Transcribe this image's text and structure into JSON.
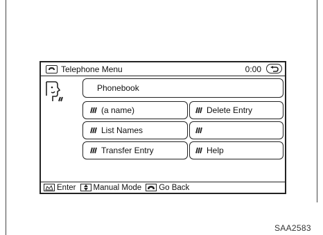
{
  "header": {
    "title": "Telephone Menu",
    "time": "0:00"
  },
  "main": {
    "phonebook_label": "Phonebook",
    "buttons": [
      {
        "label": "(a name)",
        "icon": "voice-icon"
      },
      {
        "label": "Delete Entry",
        "icon": "voice-icon"
      },
      {
        "label": "List Names",
        "icon": "voice-icon"
      },
      {
        "label": "",
        "icon": "voice-icon"
      },
      {
        "label": "Transfer Entry",
        "icon": "voice-icon"
      },
      {
        "label": "Help",
        "icon": "voice-icon"
      }
    ]
  },
  "status_bar": {
    "enter_label": "Enter",
    "manual_mode_label": "Manual Mode",
    "go_back_label": "Go Back"
  },
  "figure_code": "SAA2583",
  "colors": {
    "line": "#222222",
    "background": "#ffffff"
  }
}
